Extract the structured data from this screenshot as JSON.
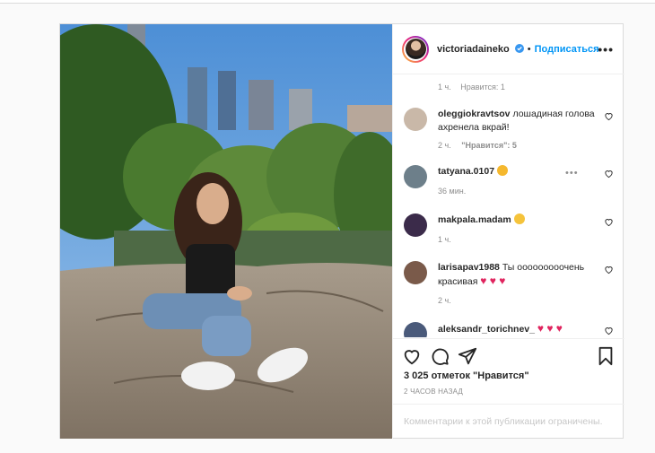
{
  "header": {
    "username": "victoriadaineko",
    "follow_label": "Подписаться",
    "more_label": "•••"
  },
  "comments_meta_top": {
    "time": "1 ч.",
    "likes": "Нравится: 1"
  },
  "comments": [
    {
      "user": "oleggiokravtsov",
      "text": "лошадиная голова ахренела вкрай!",
      "time": "2 ч.",
      "likes": "\"Нравится\": 5",
      "avatar_color": "#c9b8a8"
    },
    {
      "user": "tatyana.0107",
      "text": "",
      "emoji": "heart-eyes",
      "time": "36 мин.",
      "likes": "",
      "avatar_color": "#6d7f8a"
    },
    {
      "user": "makpala.madam",
      "text": "",
      "emoji": "thinking",
      "time": "1 ч.",
      "likes": "",
      "avatar_color": "#3b2b4a"
    },
    {
      "user": "larisapav1988",
      "text": "Ты ооооооооочень красивая",
      "hearts": "♥ ♥ ♥",
      "time": "2 ч.",
      "likes": "",
      "avatar_color": "#7a5a4a"
    },
    {
      "user": "aleksandr_torichnev_",
      "text": "",
      "hearts": "♥ ♥ ♥",
      "time": "",
      "likes": "",
      "avatar_color": "#4a5a7a"
    }
  ],
  "actions": {
    "like_icon": "heart-outline-icon",
    "comment_icon": "comment-icon",
    "share_icon": "paper-plane-icon",
    "save_icon": "bookmark-icon"
  },
  "likes_count": "3 025 отметок \"Нравится\"",
  "post_time": "2 ЧАСОВ НАЗАД",
  "comments_restricted": "Комментарии к этой публикации ограничены.",
  "colors": {
    "accent": "#0095f6",
    "verified": "#3897f0",
    "heart_red": "#e0245e"
  }
}
